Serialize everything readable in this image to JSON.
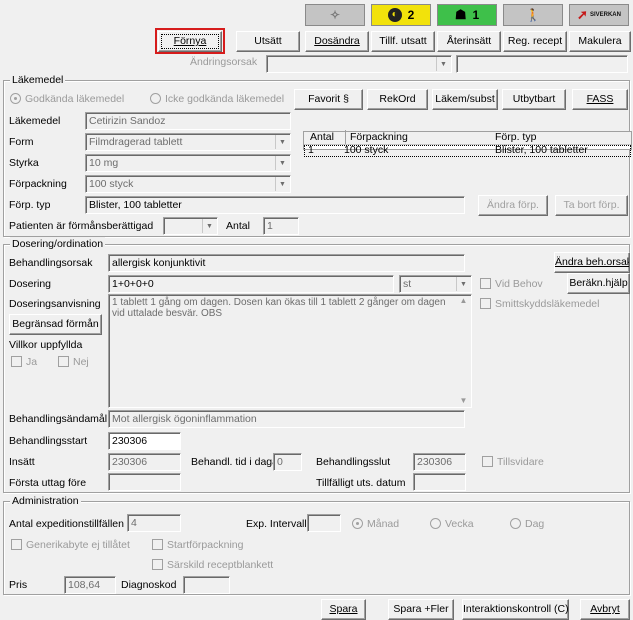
{
  "toolbar": {
    "badge_yellow": "2",
    "badge_green": "1",
    "logo_text": "SIVERKAN"
  },
  "actions": {
    "fornya": "Förnya",
    "utsatt": "Utsätt",
    "dosandra": "Dosändra",
    "tillf_utsatt": "Tillf. utsatt",
    "aterinsatt": "Återinsätt",
    "reg_recept": "Reg. recept",
    "makulera": "Makulera",
    "andringsorsak_label": "Ändringsorsak"
  },
  "lakemedel": {
    "title": "Läkemedel",
    "radio_godkanda": "Godkända läkemedel",
    "radio_icke": "Icke godkända läkemedel",
    "btn_favorit": "Favorit §",
    "btn_rekord": "RekOrd",
    "btn_lakem": "Läkem/subst",
    "btn_utbytbart": "Utbytbart",
    "btn_fass": "FASS",
    "lakemedel_label": "Läkemedel",
    "lakemedel_value": "Cetirizin Sandoz",
    "form_label": "Form",
    "form_value": "Filmdragerad tablett",
    "styrka_label": "Styrka",
    "styrka_value": "10 mg",
    "forpackning_label": "Förpackning",
    "forpackning_value": "100 styck",
    "forp_typ_label": "Förp. typ",
    "forp_typ_value": "Blister, 100 tabletter",
    "btn_andra_forp": "Ändra förp.",
    "btn_ta_bort_forp": "Ta bort förp.",
    "formansberattigad_label": "Patienten är förmånsberättigad",
    "antal_label": "Antal",
    "antal_value": "1",
    "table_headers": [
      "Antal",
      "Förpackning",
      "Förp. typ"
    ],
    "table_row": [
      "1",
      "100 styck",
      "Blister, 100 tabletter"
    ]
  },
  "dosering": {
    "title": "Dosering/ordination",
    "behandlingsorsak_label": "Behandlingsorsak",
    "behandlingsorsak_value": "allergisk konjunktivit",
    "btn_andra_beh": "Ändra beh.orsak",
    "dosering_label": "Dosering",
    "dosering_value": "1+0+0+0",
    "unit_value": "st",
    "vid_behov": "Vid Behov",
    "btn_berakn": "Beräkn.hjälp",
    "doseringsanvisning_label": "Doseringsanvisning",
    "doseringsanvisning_value": "1 tablett 1 gång om dagen. Dosen kan ökas till 1 tablett 2 gånger om dagen vid uttalade besvär. OBS",
    "smittskydd": "Smittskyddsläkemedel",
    "btn_begransad": "Begränsad förmån",
    "villkor_label": "Villkor uppfyllda",
    "ja": "Ja",
    "nej": "Nej",
    "behandlingsandamal_label": "Behandlingsändamål",
    "behandlingsandamal_value": "Mot allergisk ögoninflammation",
    "behandlingsstart_label": "Behandlingsstart",
    "behandlingsstart_value": "230306",
    "insatt_label": "Insätt",
    "insatt_value": "230306",
    "tid_label": "Behandl. tid i dagar",
    "tid_value": "0",
    "slut_label": "Behandlingsslut",
    "slut_value": "230306",
    "tillsvidare": "Tillsvidare",
    "forsta_uttag_label": "Första uttag före",
    "tillfalligt_label": "Tillfälligt uts. datum"
  },
  "admin": {
    "title": "Administration",
    "antal_exp_label": "Antal expeditionstillfällen",
    "antal_exp_value": "4",
    "exp_intervall_label": "Exp. Intervall",
    "manad": "Månad",
    "vecka": "Vecka",
    "dag": "Dag",
    "generika": "Generikabyte ej tillåtet",
    "startforp": "Startförpackning",
    "sarskild": "Särskild receptblankett",
    "pris_label": "Pris",
    "pris_value": "108,64",
    "diagnoskod_label": "Diagnoskod"
  },
  "footer": {
    "spara": "Spara",
    "spara_fler": "Spara +Fler",
    "interaktion": "Interaktionskontroll (C)",
    "avbryt": "Avbryt"
  },
  "colors": {
    "highlight": "#d61c1c",
    "yellow": "#f2e20b",
    "green": "#3ec04a"
  }
}
